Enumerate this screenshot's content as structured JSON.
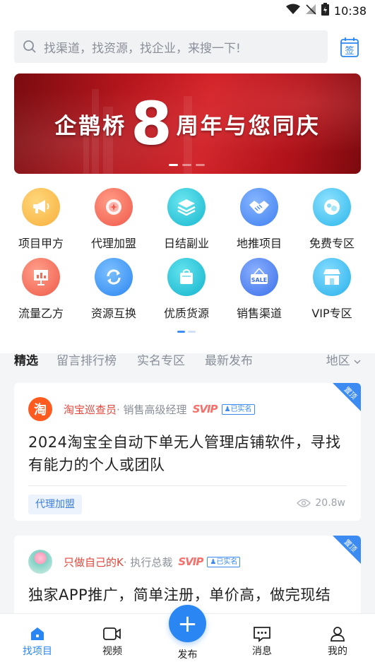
{
  "status_bar": {
    "time": "10:38"
  },
  "search": {
    "placeholder": "找渠道，找资源，找企业，来搜一下!",
    "sign_label": "签"
  },
  "banner": {
    "prefix": "企鹊桥",
    "number": "8",
    "suffix": "周年与您同庆",
    "pages": 3,
    "active_page": 1
  },
  "categories": [
    {
      "label": "项目甲方",
      "icon": "megaphone-icon",
      "color": "#f7b94a"
    },
    {
      "label": "代理加盟",
      "icon": "target-icon",
      "color": "#f46a5a"
    },
    {
      "label": "日结副业",
      "icon": "layers-icon",
      "color": "#2dc7d9"
    },
    {
      "label": "地推项目",
      "icon": "handshake-icon",
      "color": "#4a8ff0"
    },
    {
      "label": "免费专区",
      "icon": "gift-icon",
      "color": "#3fc6ec"
    },
    {
      "label": "流量乙方",
      "icon": "presentation-board-icon",
      "color": "#f26c5b"
    },
    {
      "label": "资源互换",
      "icon": "exchange-icon",
      "color": "#3a9af2"
    },
    {
      "label": "优质货源",
      "icon": "shopping-bag-icon",
      "color": "#25c5d9"
    },
    {
      "label": "销售渠道",
      "icon": "sale-sign-icon",
      "color": "#4a7ff0"
    },
    {
      "label": "VIP专区",
      "icon": "storefront-icon",
      "color": "#3bc3ee"
    }
  ],
  "tabs": [
    {
      "label": "精选",
      "active": true
    },
    {
      "label": "留言排行榜",
      "active": false
    },
    {
      "label": "实名专区",
      "active": false
    },
    {
      "label": "最新发布",
      "active": false
    }
  ],
  "region": {
    "label": "地区"
  },
  "posts": [
    {
      "pin": "置顶",
      "username": "淘宝巡查员",
      "role": "· 销售高级经理",
      "vip": "SVIP",
      "verified": "已实名",
      "title": "2024淘宝全自动下单无人管理店铺软件，寻找有能力的个人或团队",
      "tag": "代理加盟",
      "views": "20.8w"
    },
    {
      "pin": "置顶",
      "username": "只做自己的K",
      "role": "· 执行总裁",
      "vip": "SVIP",
      "verified": "已实名",
      "title": "独家APP推广，简单注册，单价高，做完现结"
    }
  ],
  "bottom_nav": [
    {
      "label": "找项目",
      "icon": "home-icon",
      "active": true
    },
    {
      "label": "视频",
      "icon": "video-camera-icon",
      "active": false
    },
    {
      "label": "发布",
      "icon": "plus-icon",
      "active": false
    },
    {
      "label": "消息",
      "icon": "message-icon",
      "active": false
    },
    {
      "label": "我的",
      "icon": "user-icon",
      "active": false
    }
  ],
  "colors": {
    "accent": "#2a86f3",
    "username": "#e4453a",
    "svip": "#f5706b"
  }
}
